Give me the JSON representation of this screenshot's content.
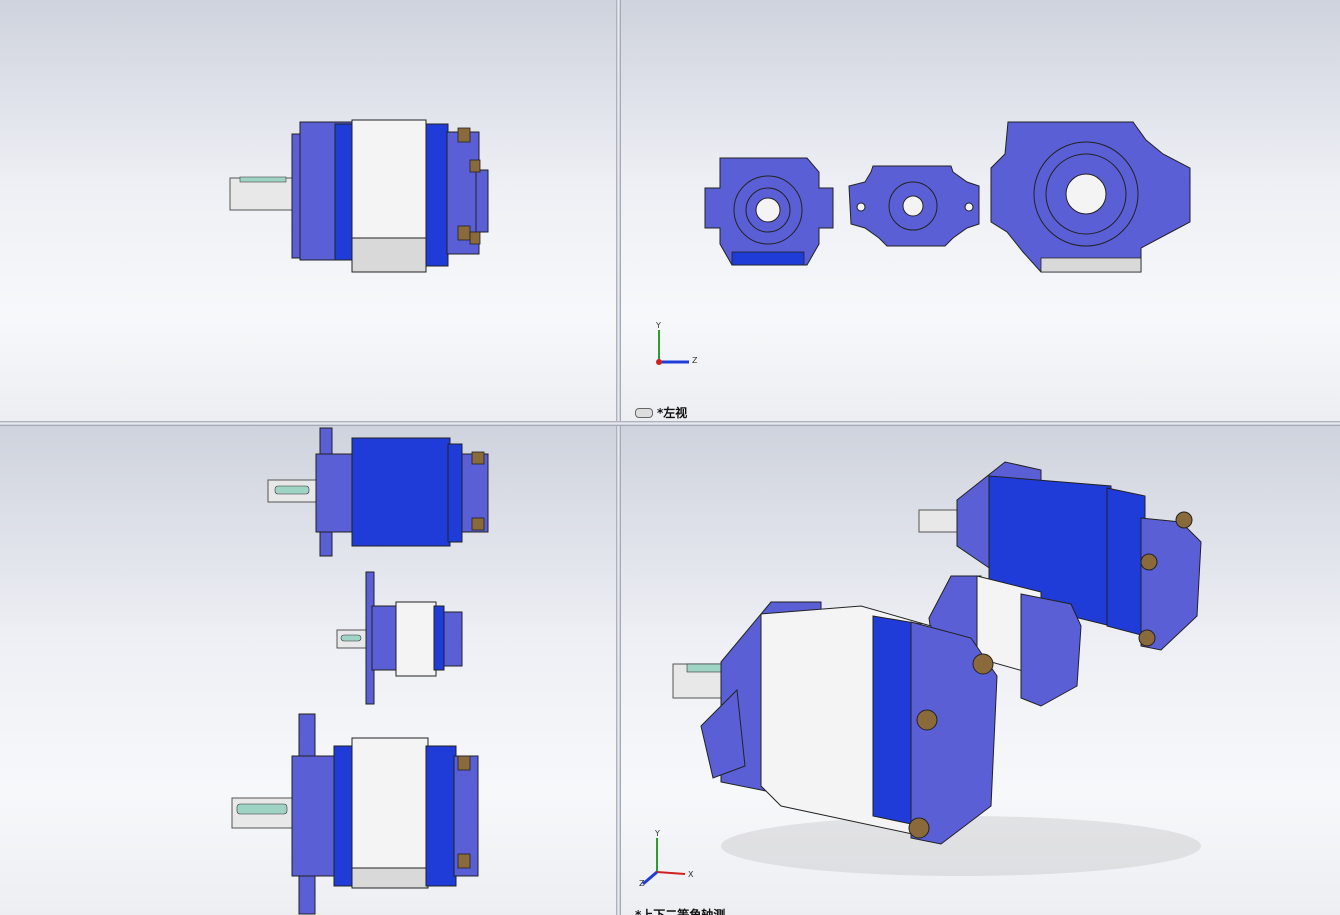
{
  "viewports": {
    "top_right": {
      "view_label": "*左视",
      "axis_labels": {
        "y": "Y",
        "z": "Z"
      }
    },
    "bottom_right": {
      "view_label": "*上下二等角轴测",
      "axis_labels": {
        "y": "Y",
        "x": "X",
        "z": "Z"
      }
    }
  },
  "colors": {
    "pump_blue_dark": "#1f3cd8",
    "pump_blue_light": "#5a5fd6",
    "housing_white": "#f4f4f4",
    "bolt_bronze": "#8a6a3a",
    "shaft_grey": "#dcdcdc"
  },
  "icons": [
    "view-link-icon",
    "triad-axis-icon"
  ]
}
